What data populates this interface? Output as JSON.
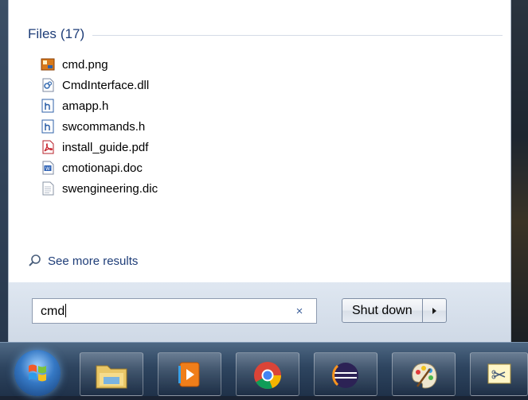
{
  "start_menu": {
    "files_header": {
      "title": "Files",
      "count": "(17)"
    },
    "files": [
      {
        "name": "cmd.png",
        "icon": "image-file-icon"
      },
      {
        "name": "CmdInterface.dll",
        "icon": "dll-file-icon"
      },
      {
        "name": "amapp.h",
        "icon": "header-file-icon"
      },
      {
        "name": "swcommands.h",
        "icon": "header-file-icon"
      },
      {
        "name": "install_guide.pdf",
        "icon": "pdf-file-icon"
      },
      {
        "name": "cmotionapi.doc",
        "icon": "word-doc-icon"
      },
      {
        "name": "swengineering.dic",
        "icon": "text-file-icon"
      }
    ],
    "see_more": "See more results",
    "search": {
      "value": "cmd",
      "clear_glyph": "×"
    },
    "shutdown": {
      "label": "Shut down",
      "arrow_glyph": "▸"
    }
  },
  "taskbar": {
    "items": [
      {
        "name": "windows-explorer",
        "icon": "folder-icon"
      },
      {
        "name": "media-player",
        "icon": "media-player-icon"
      },
      {
        "name": "chrome",
        "icon": "chrome-icon"
      },
      {
        "name": "eclipse",
        "icon": "eclipse-icon"
      },
      {
        "name": "paint",
        "icon": "paint-palette-icon"
      },
      {
        "name": "snipping",
        "icon": "snipping-tool-icon"
      }
    ]
  },
  "colors": {
    "link_blue": "#1e3d78",
    "menu_bg": "#ffffff",
    "taskbar": "#2e4560"
  }
}
